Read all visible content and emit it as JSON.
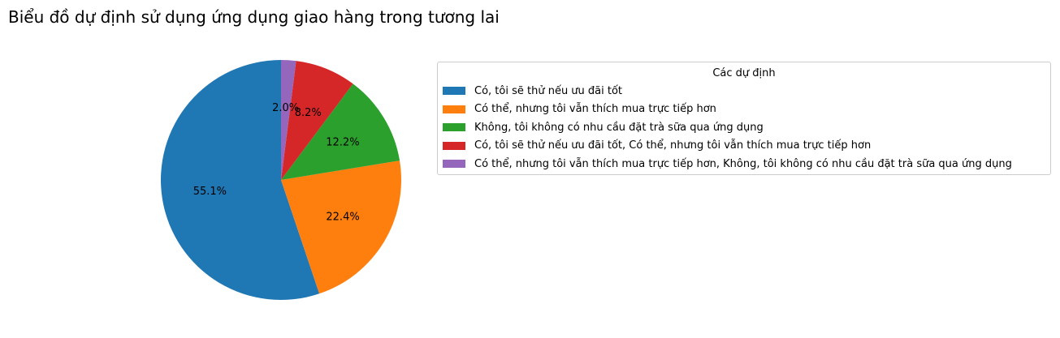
{
  "chart_data": {
    "type": "pie",
    "title": "Biểu đồ dự định sử dụng ứng dụng giao hàng trong tương lai",
    "legend_title": "Các dự định",
    "legend_position": "right",
    "start_angle": 90,
    "direction": "counterclockwise",
    "slices": [
      {
        "label": "Có, tôi sẽ thử nếu ưu đãi tốt",
        "value": 55.1,
        "pct_label": "55.1%",
        "color": "#1f77b4"
      },
      {
        "label": "Có thể, nhưng tôi vẫn thích mua trực tiếp hơn",
        "value": 22.4,
        "pct_label": "22.4%",
        "color": "#ff7f0e"
      },
      {
        "label": "Không, tôi không có nhu cầu đặt trà sữa qua ứng dụng",
        "value": 12.2,
        "pct_label": "12.2%",
        "color": "#2ca02c"
      },
      {
        "label": "Có, tôi sẽ thử nếu ưu đãi tốt, Có thể, nhưng tôi vẫn thích mua trực tiếp hơn",
        "value": 8.2,
        "pct_label": "8.2%",
        "color": "#d62728"
      },
      {
        "label": "Có thể, nhưng tôi vẫn thích mua trực tiếp hơn, Không, tôi không có nhu cầu đặt trà sữa qua ứng dụng",
        "value": 2.0,
        "pct_label": "2.0%",
        "color": "#9467bd"
      }
    ]
  }
}
